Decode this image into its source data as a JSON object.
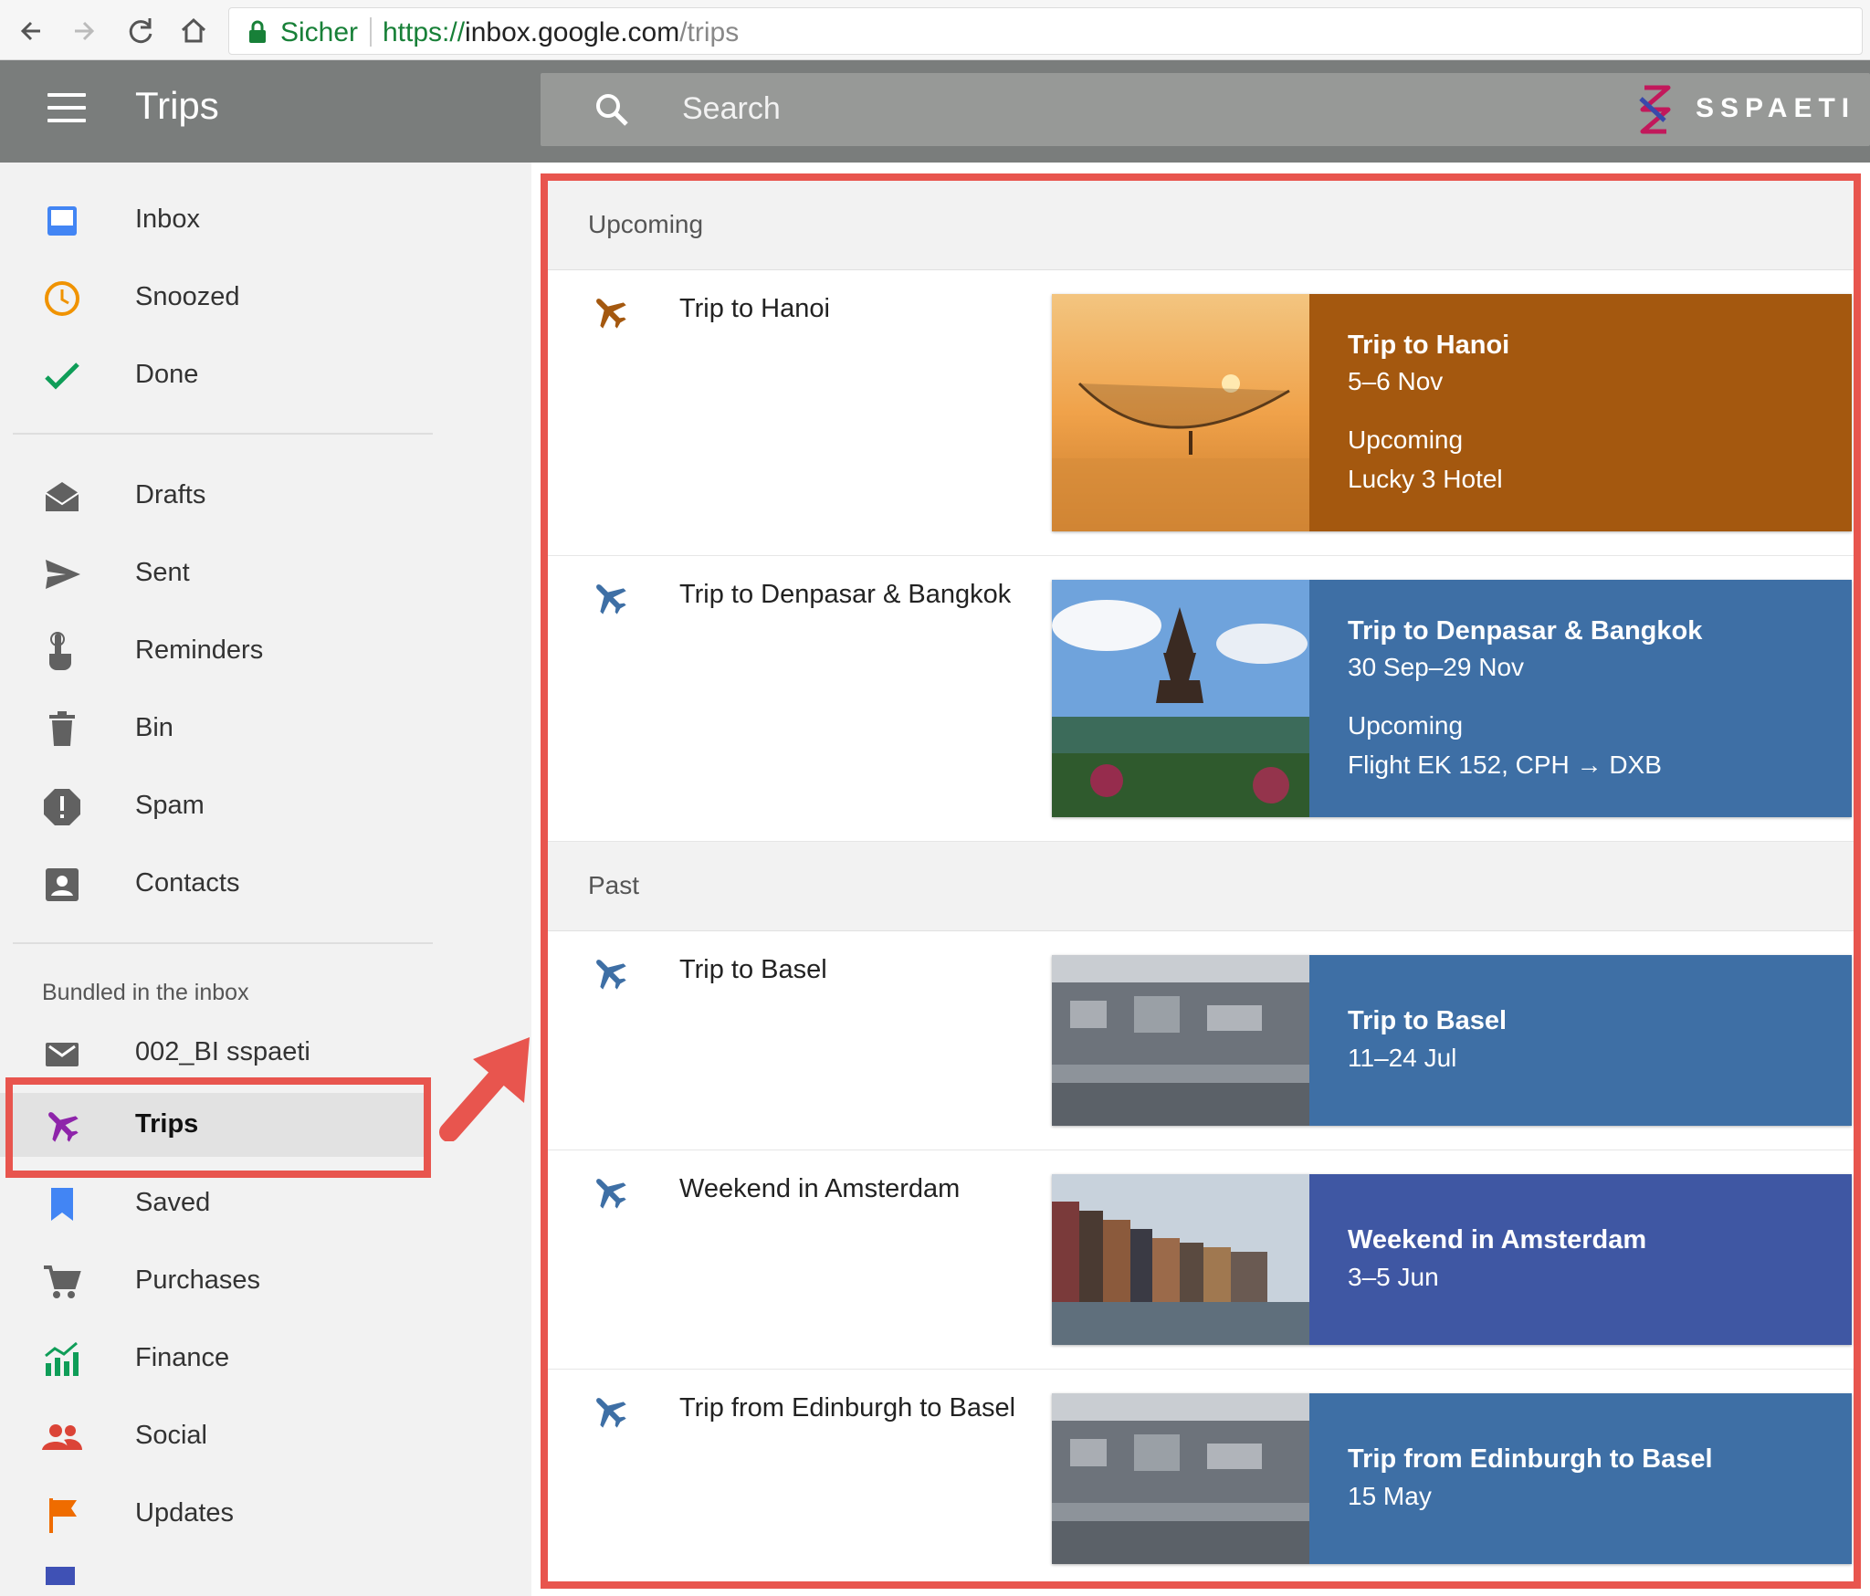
{
  "browser": {
    "secure_label": "Sicher",
    "url_proto": "https://",
    "url_host": "inbox.google.com",
    "url_path": "/trips"
  },
  "header": {
    "title": "Trips",
    "search_placeholder": "Search",
    "brand": "SSPAETI"
  },
  "sidebar": {
    "items": [
      {
        "label": "Inbox",
        "icon": "inbox-icon"
      },
      {
        "label": "Snoozed",
        "icon": "clock-icon"
      },
      {
        "label": "Done",
        "icon": "check-icon"
      },
      {
        "label": "Drafts",
        "icon": "drafts-icon"
      },
      {
        "label": "Sent",
        "icon": "send-icon"
      },
      {
        "label": "Reminders",
        "icon": "reminder-icon"
      },
      {
        "label": "Bin",
        "icon": "trash-icon"
      },
      {
        "label": "Spam",
        "icon": "spam-icon"
      },
      {
        "label": "Contacts",
        "icon": "contacts-icon"
      }
    ],
    "bundled_heading": "Bundled in the inbox",
    "bundles": [
      {
        "label": "002_BI sspaeti",
        "icon": "mail-bundle-icon"
      },
      {
        "label": "Trips",
        "icon": "plane-icon"
      },
      {
        "label": "Saved",
        "icon": "bookmark-icon"
      },
      {
        "label": "Purchases",
        "icon": "cart-icon"
      },
      {
        "label": "Finance",
        "icon": "finance-icon"
      },
      {
        "label": "Social",
        "icon": "people-icon"
      },
      {
        "label": "Updates",
        "icon": "flag-icon"
      }
    ]
  },
  "main": {
    "sections": [
      {
        "label": "Upcoming"
      },
      {
        "label": "Past"
      }
    ],
    "trips": [
      {
        "name": "Trip to Hanoi",
        "card_title": "Trip to Hanoi",
        "dates": "5–6 Nov",
        "status": "Upcoming",
        "detail": "Lucky 3 Hotel",
        "color": "#a4580f",
        "icon_color": "#a4580f"
      },
      {
        "name": "Trip to Denpasar & Bangkok",
        "card_title": "Trip to Denpasar & Bangkok",
        "dates": "30 Sep–29 Nov",
        "status": "Upcoming",
        "detail": "Flight EK 152, CPH → DXB",
        "color": "#3e6fa5",
        "icon_color": "#3e6fa5"
      },
      {
        "name": "Trip to Basel",
        "card_title": "Trip to Basel",
        "dates": "11–24 Jul",
        "color": "#3e6fa5",
        "icon_color": "#3e6fa5"
      },
      {
        "name": "Weekend in Amsterdam",
        "card_title": "Weekend in Amsterdam",
        "dates": "3–5 Jun",
        "color": "#3f57a3",
        "icon_color": "#3e6fa5"
      },
      {
        "name": "Trip from Edinburgh to Basel",
        "card_title": "Trip from Edinburgh to Basel",
        "dates": "15 May",
        "color": "#3e6fa5",
        "icon_color": "#3e6fa5"
      }
    ]
  },
  "colors": {
    "highlight": "#e8554e",
    "header_bg": "#7a7d7c",
    "active_trip_icon": "#8e24aa"
  }
}
